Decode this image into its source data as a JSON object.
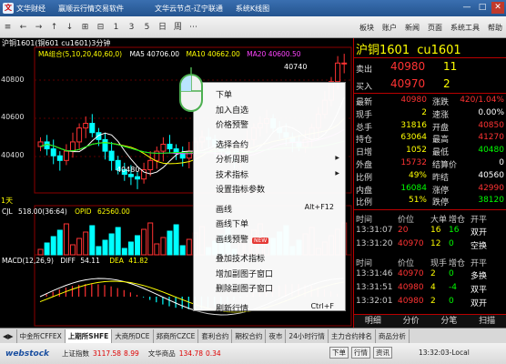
{
  "titlebar": {
    "app_name": "文华财经",
    "product": "赢顺云行情交易软件",
    "server": "文华云节点-辽宁联通",
    "mode": "系统K线图",
    "min": "—",
    "max": "□",
    "close": "✕"
  },
  "toolbar": {
    "left": [
      "≡",
      "←",
      "→",
      "↑",
      "↓",
      "⊞",
      "⊟",
      "1",
      "3",
      "5",
      "日",
      "周",
      "⋯"
    ],
    "right": [
      "板块",
      "账户",
      "新闻",
      "页面",
      "系统工具",
      "帮助"
    ]
  },
  "chart": {
    "header": "沪铜1601(铜601  cu1601)3分钟",
    "ma_label": "MA组合(5,10,20,40,60,0)",
    "ma_values": [
      {
        "label": "MA5",
        "value": "40706.00",
        "color": "#ffffff"
      },
      {
        "label": "MA10",
        "value": "40662.00",
        "color": "#ffff00"
      },
      {
        "label": "MA20",
        "value": "40600.50",
        "color": "#ff44ff"
      },
      {
        "label": "MA40",
        "value": "",
        "color": "#00ff00"
      }
    ],
    "price_axis": [
      "40800",
      "40600",
      "40400"
    ],
    "high_label": "40740",
    "low_label": "40480",
    "timeframe": "1天",
    "vol_label": "CJL",
    "vol_value": "518.00(36:64)",
    "oi_label": "OPID",
    "oi_value": "62560.00",
    "macd_label": "MACD(12,26,9)",
    "diff_label": "DIFF",
    "diff_value": "54.11",
    "dea_label": "DEA",
    "dea_value": "41.82"
  },
  "menu": {
    "items": [
      {
        "label": "下单",
        "shortcut": "",
        "arrow": false,
        "badge": ""
      },
      {
        "label": "加入自选",
        "shortcut": "",
        "arrow": false,
        "badge": ""
      },
      {
        "label": "价格预警",
        "shortcut": "",
        "arrow": false,
        "badge": ""
      },
      {
        "label": "选择合约",
        "shortcut": "",
        "arrow": false,
        "badge": ""
      },
      {
        "label": "分析周期",
        "shortcut": "",
        "arrow": true,
        "badge": ""
      },
      {
        "label": "技术指标",
        "shortcut": "",
        "arrow": true,
        "badge": ""
      },
      {
        "label": "设置指标参数",
        "shortcut": "",
        "arrow": false,
        "badge": ""
      },
      {
        "label": "画线",
        "shortcut": "Alt+F12",
        "arrow": false,
        "badge": ""
      },
      {
        "label": "画线下单",
        "shortcut": "",
        "arrow": false,
        "badge": ""
      },
      {
        "label": "画线预警",
        "shortcut": "",
        "arrow": false,
        "badge": "NEW"
      },
      {
        "label": "叠加技术指标",
        "shortcut": "",
        "arrow": false,
        "badge": ""
      },
      {
        "label": "增加副图子窗口",
        "shortcut": "",
        "arrow": false,
        "badge": ""
      },
      {
        "label": "删除副图子窗口",
        "shortcut": "",
        "arrow": false,
        "badge": ""
      },
      {
        "label": "刷新行情",
        "shortcut": "Ctrl+F",
        "arrow": false,
        "badge": ""
      }
    ]
  },
  "panel": {
    "name": "沪铜1601",
    "code": "cu1601",
    "sell": {
      "label": "卖出",
      "price": "40980",
      "vol": "11"
    },
    "buy": {
      "label": "买入",
      "price": "40970",
      "vol": "2"
    },
    "stats": [
      {
        "l": "最新",
        "v": "40980",
        "c": "#ff3333",
        "l2": "涨跌",
        "v2": "420/1.04%",
        "c2": "#ff3333"
      },
      {
        "l": "现手",
        "v": "2",
        "c": "#ffff00",
        "l2": "速涨",
        "v2": "0.00%",
        "c2": "#ffffff"
      },
      {
        "l": "总手",
        "v": "31816",
        "c": "#ffff00",
        "l2": "开盘",
        "v2": "40850",
        "c2": "#ff3333"
      },
      {
        "l": "持仓",
        "v": "63064",
        "c": "#ffff00",
        "l2": "最高",
        "v2": "41270",
        "c2": "#ff3333"
      },
      {
        "l": "日增",
        "v": "1052",
        "c": "#ffff00",
        "l2": "最低",
        "v2": "40480",
        "c2": "#00ff00"
      },
      {
        "l": "外盘",
        "v": "15732",
        "c": "#ff3333",
        "l2": "结算价",
        "v2": "0",
        "c2": "#ffffff"
      },
      {
        "l": "比例",
        "v": "49%",
        "c": "#ffff00",
        "l2": "昨结",
        "v2": "40560",
        "c2": "#ffffff"
      },
      {
        "l": "内盘",
        "v": "16084",
        "c": "#00ff00",
        "l2": "涨停",
        "v2": "42990",
        "c2": "#ff3333"
      },
      {
        "l": "比例",
        "v": "51%",
        "c": "#ffff00",
        "l2": "跌停",
        "v2": "38120",
        "c2": "#00ff00"
      }
    ],
    "ticks_header": [
      "时间",
      "价位",
      "大单",
      "增仓",
      "开平"
    ],
    "ticks": [
      {
        "t": "13:31:07",
        "p": "20",
        "b": "16",
        "i": "16",
        "o": "双开"
      },
      {
        "t": "13:31:20",
        "p": "40970",
        "b": "12",
        "i": "0",
        "o": "空换"
      }
    ],
    "ticks_header2": [
      "时间",
      "价位",
      "现手",
      "增仓",
      "开平"
    ],
    "ticks2": [
      {
        "t": "13:31:46",
        "p": "40970",
        "b": "2",
        "i": "0",
        "o": "多换"
      },
      {
        "t": "13:31:51",
        "p": "40980",
        "b": "4",
        "i": "-4",
        "o": "双平"
      },
      {
        "t": "13:32:01",
        "p": "40980",
        "b": "2",
        "i": "0",
        "o": "双开"
      }
    ],
    "subtabs": [
      "明细",
      "分价",
      "分笔",
      "扫描"
    ]
  },
  "tabs": [
    "中金所CFFEX",
    "上期所SHFE",
    "大商所DCE",
    "郑商所CZCE",
    "套利合约",
    "期权合约",
    "夜市",
    "24小时行情",
    "主力合约排名",
    "商品分析"
  ],
  "active_tab": "上期所SHFE",
  "status": {
    "brand": "webstock",
    "idx1_name": "上证指数",
    "idx1_val": "3117.58",
    "idx1_chg": "8.99",
    "idx2_name": "文华商品",
    "idx2_val": "134.78",
    "idx2_chg": "0.34",
    "buttons": [
      "下单",
      "行情",
      "资讯"
    ],
    "clock": "13:32:03-Local"
  },
  "colors": {
    "up": "#ff3333",
    "down": "#00ffff",
    "bg": "#000000",
    "grid": "#8b0000"
  }
}
